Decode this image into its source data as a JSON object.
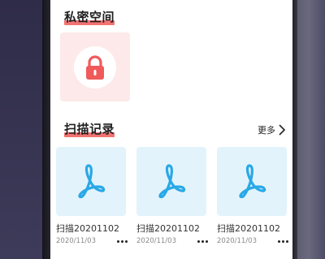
{
  "private_space": {
    "title": "私密空间",
    "icon": "lock-icon",
    "accent": "#f05a5a",
    "tile_bg": "#fde9e9"
  },
  "scan_records": {
    "title": "扫描记录",
    "more_label": "更多",
    "items": [
      {
        "name": "扫描20201102",
        "date": "2020/11/03",
        "icon": "pdf-icon"
      },
      {
        "name": "扫描20201102",
        "date": "2020/11/03",
        "icon": "pdf-icon"
      },
      {
        "name": "扫描20201102",
        "date": "2020/11/03",
        "icon": "pdf-icon"
      }
    ],
    "thumb_bg": "#e3f3fc",
    "icon_color": "#29a8e6"
  }
}
